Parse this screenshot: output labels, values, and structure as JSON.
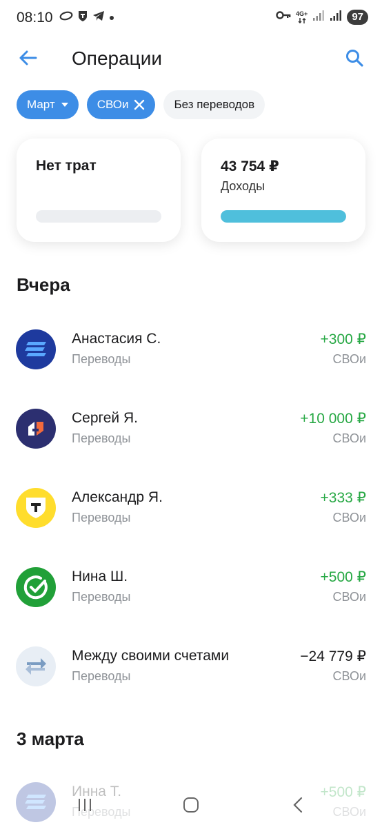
{
  "status": {
    "time": "08:10",
    "network": "4G+",
    "battery": "97"
  },
  "header": {
    "title": "Операции"
  },
  "filters": {
    "month": "Март",
    "account": "СВОи",
    "transfers": "Без переводов"
  },
  "cards": {
    "spending": {
      "title": "Нет трат",
      "fill": 0
    },
    "income": {
      "amount": "43 754 ₽",
      "label": "Доходы",
      "fill": 1
    }
  },
  "sections": [
    {
      "title": "Вчера",
      "items": [
        {
          "name": "Анастасия С.",
          "category": "Переводы",
          "amount": "+300 ₽",
          "account": "СВОи",
          "icon": "bank-stripes-icon",
          "color": "#1e3a9e"
        },
        {
          "name": "Сергей Я.",
          "category": "Переводы",
          "amount": "+10 000 ₽",
          "account": "СВОи",
          "icon": "bank-logo-icon",
          "color": "#2c2f70"
        },
        {
          "name": "Александр Я.",
          "category": "Переводы",
          "amount": "+333 ₽",
          "account": "СВОи",
          "icon": "t-shield-icon",
          "color": "#ffdd2d"
        },
        {
          "name": "Нина Ш.",
          "category": "Переводы",
          "amount": "+500 ₽",
          "account": "СВОи",
          "icon": "check-circle-icon",
          "color": "#21a038"
        },
        {
          "name": "Между своими счетами",
          "category": "Переводы",
          "amount": "−24 779 ₽",
          "account": "СВОи",
          "icon": "swap-arrows-icon",
          "color": "#e8eef5"
        }
      ]
    },
    {
      "title": "3 марта",
      "items": [
        {
          "name": "Инна Т.",
          "category": "Переводы",
          "amount": "+500 ₽",
          "account": "СВОи",
          "icon": "bank-stripes-icon",
          "color": "#c9d7f0"
        }
      ]
    }
  ]
}
